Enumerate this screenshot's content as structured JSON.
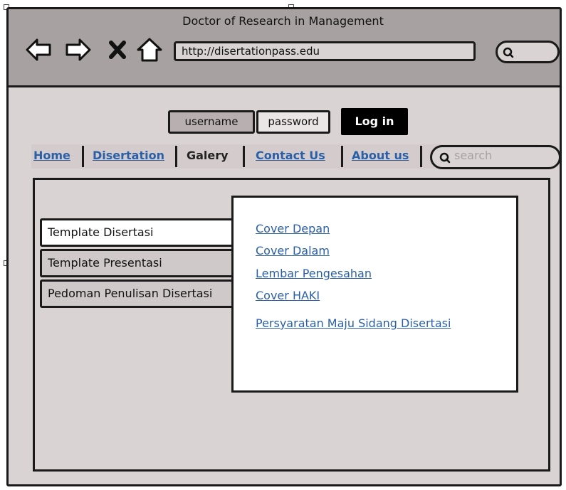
{
  "window": {
    "title": "Doctor of Research in Management",
    "url": "http://disertationpass.edu"
  },
  "login_form": {
    "username_placeholder": "username",
    "password_placeholder": "password",
    "login_label": "Log in"
  },
  "nav": {
    "items": [
      {
        "label": "Home",
        "state": "link"
      },
      {
        "label": "Disertation",
        "state": "link"
      },
      {
        "label": "Galery",
        "state": "current"
      },
      {
        "label": "Contact Us",
        "state": "link"
      },
      {
        "label": "About us",
        "state": "link"
      }
    ],
    "search_placeholder": "search"
  },
  "side_menu": {
    "items": [
      {
        "label": "Template Disertasi",
        "selected": true
      },
      {
        "label": "Template Presentasi",
        "selected": false
      },
      {
        "label": "Pedoman Penulisan Disertasi",
        "selected": false
      }
    ]
  },
  "submenu_links": [
    "Cover Depan",
    "Cover Dalam",
    "Lembar Pengesahan",
    "Cover HAKI",
    "Persyaratan Maju Sidang Disertasi"
  ],
  "colors": {
    "frame": "#d9d3d3",
    "titlebar": "#a8a1a1",
    "link": "#2b5fa6",
    "border": "#1a1a1a"
  },
  "icons": [
    "back-arrow-icon",
    "forward-arrow-icon",
    "close-icon",
    "home-icon",
    "search-icon"
  ]
}
